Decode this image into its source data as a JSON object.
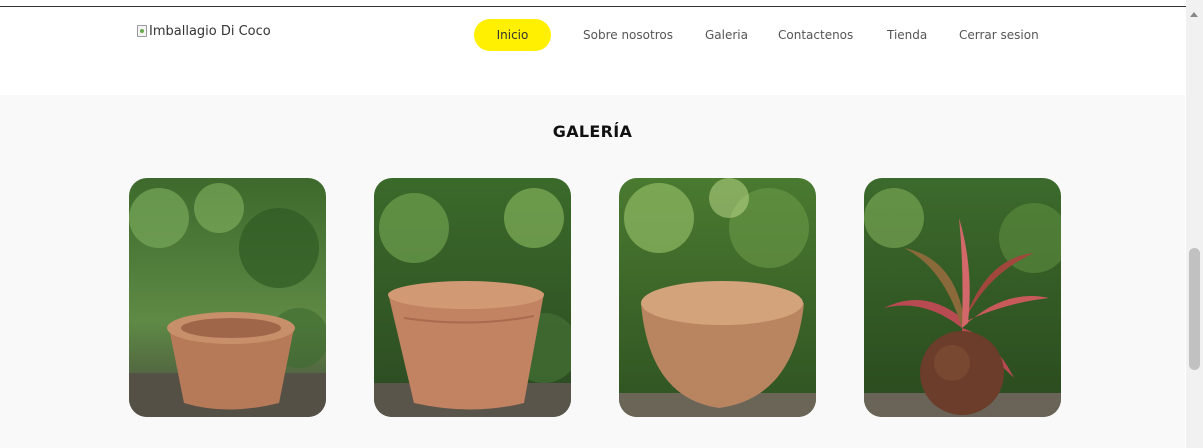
{
  "brand": {
    "logo_alt": "Imballagio Di Coco"
  },
  "nav": {
    "items": [
      {
        "label": "Inicio",
        "active": true
      },
      {
        "label": "Sobre nosotros"
      },
      {
        "label": "Galeria"
      },
      {
        "label": "Contactenos"
      },
      {
        "label": "Tienda"
      },
      {
        "label": "Cerrar sesion"
      }
    ]
  },
  "gallery": {
    "title": "GALERÍA",
    "images": [
      {
        "subject": "small coco fiber pot"
      },
      {
        "subject": "tall coco fiber pot"
      },
      {
        "subject": "wide coco fiber hanging basket"
      },
      {
        "subject": "kokedama with red plant"
      }
    ]
  },
  "colors": {
    "accent": "#ffef00",
    "background": "#f9f9f9",
    "coir": "#c08060"
  }
}
